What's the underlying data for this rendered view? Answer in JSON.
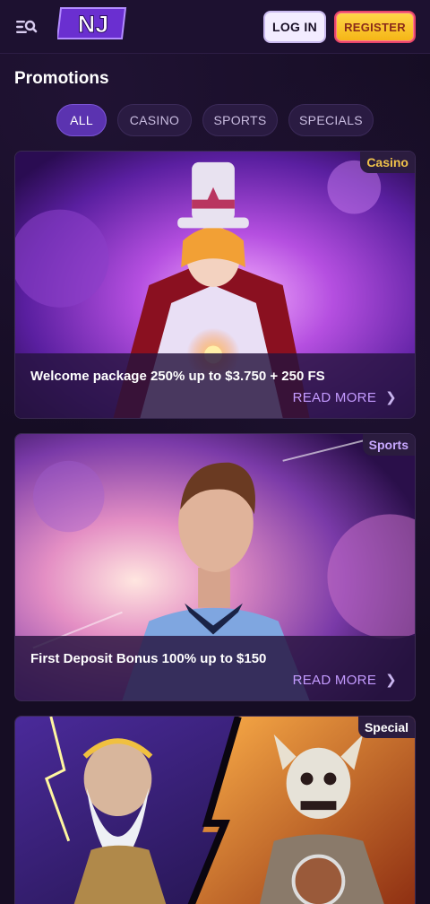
{
  "header": {
    "logo_text": "NJ",
    "login_label": "LOG IN",
    "register_label": "REGISTER",
    "menu_icon": "menu-search-icon"
  },
  "page": {
    "title": "Promotions"
  },
  "filters": [
    {
      "label": "ALL",
      "active": true
    },
    {
      "label": "CASINO",
      "active": false
    },
    {
      "label": "SPORTS",
      "active": false
    },
    {
      "label": "SPECIALS",
      "active": false
    }
  ],
  "promos": [
    {
      "badge": "Casino",
      "title": "Welcome package 250% up to $3.750 + 250 FS",
      "cta": "READ MORE"
    },
    {
      "badge": "Sports",
      "title": "First Deposit Bonus 100% up to $150",
      "cta": "READ MORE"
    },
    {
      "badge": "Special"
    }
  ],
  "colors": {
    "background": "#160d24",
    "accent_purple": "#5b33b0",
    "register_yellow": "#ffd64a",
    "link_purple": "#c49bff"
  }
}
